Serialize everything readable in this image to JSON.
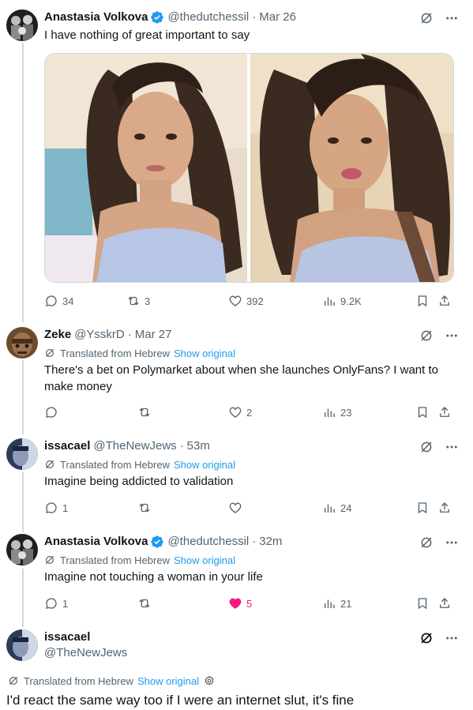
{
  "tweets": [
    {
      "name": "Anastasia Volkova",
      "verified": true,
      "handle": "@thedutchessil",
      "time": "Mar 26",
      "text": "I have nothing of great important to say",
      "counts": {
        "replies": "34",
        "reposts": "3",
        "likes": "392",
        "views": "9.2K"
      }
    },
    {
      "name": "Zeke",
      "verified": false,
      "handle": "@YsskrD",
      "time": "Mar 27",
      "translated_label": "Translated from Hebrew",
      "show_original": "Show original",
      "text": "There's a bet on Polymarket about when she launches OnlyFans? I want to make money",
      "counts": {
        "replies": "",
        "reposts": "",
        "likes": "2",
        "views": "23"
      }
    },
    {
      "name": "issacael",
      "verified": false,
      "handle": "@TheNewJews",
      "time": "53m",
      "translated_label": "Translated from Hebrew",
      "show_original": "Show original",
      "text": "Imagine being addicted to validation",
      "counts": {
        "replies": "1",
        "reposts": "",
        "likes": "",
        "views": "24"
      }
    },
    {
      "name": "Anastasia Volkova",
      "verified": true,
      "handle": "@thedutchessil",
      "time": "32m",
      "translated_label": "Translated from Hebrew",
      "show_original": "Show original",
      "text": "Imagine not touching a woman in your life",
      "counts": {
        "replies": "1",
        "reposts": "",
        "likes": "5",
        "views": "21"
      }
    }
  ],
  "focused": {
    "name": "issacael",
    "handle": "@TheNewJews",
    "translated_label": "Translated from Hebrew",
    "show_original": "Show original",
    "text": "I'd react the same way too if I were an internet slut, it's fine"
  },
  "colors": {
    "text": "#0f1419",
    "muted": "#536471",
    "link": "#1d9bf0",
    "like": "#f91880",
    "verified": "#1d9bf0",
    "line": "#cfd9de"
  },
  "icons": [
    "grok-icon",
    "more-icon",
    "reply-icon",
    "repost-icon",
    "like-icon",
    "views-icon",
    "bookmark-icon",
    "share-icon",
    "translate-icon",
    "settings-icon",
    "verified-badge-icon"
  ]
}
